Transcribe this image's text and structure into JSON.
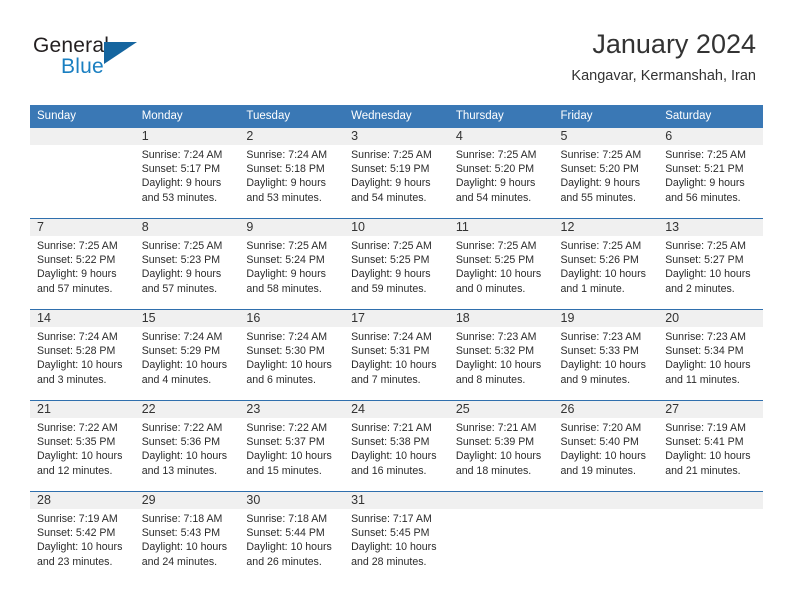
{
  "brand": {
    "name_part1": "General",
    "name_part2": "Blue",
    "logo_icon": "triangle-icon"
  },
  "header": {
    "title": "January 2024",
    "subtitle": "Kangavar, Kermanshah, Iran"
  },
  "calendar": {
    "weekday_headers": [
      "Sunday",
      "Monday",
      "Tuesday",
      "Wednesday",
      "Thursday",
      "Friday",
      "Saturday"
    ],
    "accent_color": "#3a78b5",
    "separator_color": "#2f6fad",
    "daynum_background": "#f0f0f0",
    "weeks": [
      [
        {
          "day": "",
          "sunrise": "",
          "sunset": "",
          "daylight_line1": "",
          "daylight_line2": ""
        },
        {
          "day": "1",
          "sunrise": "Sunrise: 7:24 AM",
          "sunset": "Sunset: 5:17 PM",
          "daylight_line1": "Daylight: 9 hours",
          "daylight_line2": "and 53 minutes."
        },
        {
          "day": "2",
          "sunrise": "Sunrise: 7:24 AM",
          "sunset": "Sunset: 5:18 PM",
          "daylight_line1": "Daylight: 9 hours",
          "daylight_line2": "and 53 minutes."
        },
        {
          "day": "3",
          "sunrise": "Sunrise: 7:25 AM",
          "sunset": "Sunset: 5:19 PM",
          "daylight_line1": "Daylight: 9 hours",
          "daylight_line2": "and 54 minutes."
        },
        {
          "day": "4",
          "sunrise": "Sunrise: 7:25 AM",
          "sunset": "Sunset: 5:20 PM",
          "daylight_line1": "Daylight: 9 hours",
          "daylight_line2": "and 54 minutes."
        },
        {
          "day": "5",
          "sunrise": "Sunrise: 7:25 AM",
          "sunset": "Sunset: 5:20 PM",
          "daylight_line1": "Daylight: 9 hours",
          "daylight_line2": "and 55 minutes."
        },
        {
          "day": "6",
          "sunrise": "Sunrise: 7:25 AM",
          "sunset": "Sunset: 5:21 PM",
          "daylight_line1": "Daylight: 9 hours",
          "daylight_line2": "and 56 minutes."
        }
      ],
      [
        {
          "day": "7",
          "sunrise": "Sunrise: 7:25 AM",
          "sunset": "Sunset: 5:22 PM",
          "daylight_line1": "Daylight: 9 hours",
          "daylight_line2": "and 57 minutes."
        },
        {
          "day": "8",
          "sunrise": "Sunrise: 7:25 AM",
          "sunset": "Sunset: 5:23 PM",
          "daylight_line1": "Daylight: 9 hours",
          "daylight_line2": "and 57 minutes."
        },
        {
          "day": "9",
          "sunrise": "Sunrise: 7:25 AM",
          "sunset": "Sunset: 5:24 PM",
          "daylight_line1": "Daylight: 9 hours",
          "daylight_line2": "and 58 minutes."
        },
        {
          "day": "10",
          "sunrise": "Sunrise: 7:25 AM",
          "sunset": "Sunset: 5:25 PM",
          "daylight_line1": "Daylight: 9 hours",
          "daylight_line2": "and 59 minutes."
        },
        {
          "day": "11",
          "sunrise": "Sunrise: 7:25 AM",
          "sunset": "Sunset: 5:25 PM",
          "daylight_line1": "Daylight: 10 hours",
          "daylight_line2": "and 0 minutes."
        },
        {
          "day": "12",
          "sunrise": "Sunrise: 7:25 AM",
          "sunset": "Sunset: 5:26 PM",
          "daylight_line1": "Daylight: 10 hours",
          "daylight_line2": "and 1 minute."
        },
        {
          "day": "13",
          "sunrise": "Sunrise: 7:25 AM",
          "sunset": "Sunset: 5:27 PM",
          "daylight_line1": "Daylight: 10 hours",
          "daylight_line2": "and 2 minutes."
        }
      ],
      [
        {
          "day": "14",
          "sunrise": "Sunrise: 7:24 AM",
          "sunset": "Sunset: 5:28 PM",
          "daylight_line1": "Daylight: 10 hours",
          "daylight_line2": "and 3 minutes."
        },
        {
          "day": "15",
          "sunrise": "Sunrise: 7:24 AM",
          "sunset": "Sunset: 5:29 PM",
          "daylight_line1": "Daylight: 10 hours",
          "daylight_line2": "and 4 minutes."
        },
        {
          "day": "16",
          "sunrise": "Sunrise: 7:24 AM",
          "sunset": "Sunset: 5:30 PM",
          "daylight_line1": "Daylight: 10 hours",
          "daylight_line2": "and 6 minutes."
        },
        {
          "day": "17",
          "sunrise": "Sunrise: 7:24 AM",
          "sunset": "Sunset: 5:31 PM",
          "daylight_line1": "Daylight: 10 hours",
          "daylight_line2": "and 7 minutes."
        },
        {
          "day": "18",
          "sunrise": "Sunrise: 7:23 AM",
          "sunset": "Sunset: 5:32 PM",
          "daylight_line1": "Daylight: 10 hours",
          "daylight_line2": "and 8 minutes."
        },
        {
          "day": "19",
          "sunrise": "Sunrise: 7:23 AM",
          "sunset": "Sunset: 5:33 PM",
          "daylight_line1": "Daylight: 10 hours",
          "daylight_line2": "and 9 minutes."
        },
        {
          "day": "20",
          "sunrise": "Sunrise: 7:23 AM",
          "sunset": "Sunset: 5:34 PM",
          "daylight_line1": "Daylight: 10 hours",
          "daylight_line2": "and 11 minutes."
        }
      ],
      [
        {
          "day": "21",
          "sunrise": "Sunrise: 7:22 AM",
          "sunset": "Sunset: 5:35 PM",
          "daylight_line1": "Daylight: 10 hours",
          "daylight_line2": "and 12 minutes."
        },
        {
          "day": "22",
          "sunrise": "Sunrise: 7:22 AM",
          "sunset": "Sunset: 5:36 PM",
          "daylight_line1": "Daylight: 10 hours",
          "daylight_line2": "and 13 minutes."
        },
        {
          "day": "23",
          "sunrise": "Sunrise: 7:22 AM",
          "sunset": "Sunset: 5:37 PM",
          "daylight_line1": "Daylight: 10 hours",
          "daylight_line2": "and 15 minutes."
        },
        {
          "day": "24",
          "sunrise": "Sunrise: 7:21 AM",
          "sunset": "Sunset: 5:38 PM",
          "daylight_line1": "Daylight: 10 hours",
          "daylight_line2": "and 16 minutes."
        },
        {
          "day": "25",
          "sunrise": "Sunrise: 7:21 AM",
          "sunset": "Sunset: 5:39 PM",
          "daylight_line1": "Daylight: 10 hours",
          "daylight_line2": "and 18 minutes."
        },
        {
          "day": "26",
          "sunrise": "Sunrise: 7:20 AM",
          "sunset": "Sunset: 5:40 PM",
          "daylight_line1": "Daylight: 10 hours",
          "daylight_line2": "and 19 minutes."
        },
        {
          "day": "27",
          "sunrise": "Sunrise: 7:19 AM",
          "sunset": "Sunset: 5:41 PM",
          "daylight_line1": "Daylight: 10 hours",
          "daylight_line2": "and 21 minutes."
        }
      ],
      [
        {
          "day": "28",
          "sunrise": "Sunrise: 7:19 AM",
          "sunset": "Sunset: 5:42 PM",
          "daylight_line1": "Daylight: 10 hours",
          "daylight_line2": "and 23 minutes."
        },
        {
          "day": "29",
          "sunrise": "Sunrise: 7:18 AM",
          "sunset": "Sunset: 5:43 PM",
          "daylight_line1": "Daylight: 10 hours",
          "daylight_line2": "and 24 minutes."
        },
        {
          "day": "30",
          "sunrise": "Sunrise: 7:18 AM",
          "sunset": "Sunset: 5:44 PM",
          "daylight_line1": "Daylight: 10 hours",
          "daylight_line2": "and 26 minutes."
        },
        {
          "day": "31",
          "sunrise": "Sunrise: 7:17 AM",
          "sunset": "Sunset: 5:45 PM",
          "daylight_line1": "Daylight: 10 hours",
          "daylight_line2": "and 28 minutes."
        },
        {
          "day": "",
          "sunrise": "",
          "sunset": "",
          "daylight_line1": "",
          "daylight_line2": ""
        },
        {
          "day": "",
          "sunrise": "",
          "sunset": "",
          "daylight_line1": "",
          "daylight_line2": ""
        },
        {
          "day": "",
          "sunrise": "",
          "sunset": "",
          "daylight_line1": "",
          "daylight_line2": ""
        }
      ]
    ]
  }
}
